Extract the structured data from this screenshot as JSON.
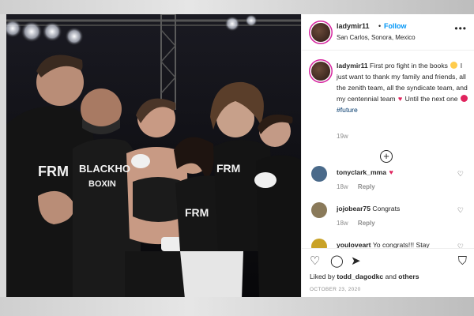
{
  "header": {
    "username": "ladymir11",
    "separator": "•",
    "follow_label": "Follow",
    "location": "San Carlos, Sonora, Mexico",
    "more_icon": "more-horizontal-icon"
  },
  "caption": {
    "username": "ladymir11",
    "text_part1": "First pro fight in the books",
    "text_part2": "I just want to thank my family and friends, all the zenith team, all the syndicate team, and my centennial team",
    "text_part3": "Until the next one",
    "hashtag": "#future",
    "time": "19w"
  },
  "comments": [
    {
      "username": "tonyclark_mma",
      "text": "",
      "time": "18w",
      "reply_label": "Reply",
      "avatar_color": "#4a6a8a"
    },
    {
      "username": "jojobear75",
      "text": "Congrats",
      "time": "18w",
      "reply_label": "Reply",
      "avatar_color": "#8a7a5a"
    },
    {
      "username": "youloveart",
      "text": "Yo congrats!!! Stay",
      "time": "",
      "reply_label": "",
      "avatar_color": "#c9a227"
    }
  ],
  "actions": {
    "like_icon": "heart-icon",
    "comment_icon": "comment-icon",
    "share_icon": "share-icon",
    "save_icon": "bookmark-icon",
    "liked_by_prefix": "Liked by",
    "liked_by_user": "todd_dagodkc",
    "liked_by_and": "and",
    "liked_by_others": "others",
    "date": "OCTOBER 23, 2020"
  },
  "photo": {
    "shirt_text_1": "FRM",
    "shirt_text_2": "BLACKHO",
    "shirt_text_3": "BOXIN",
    "shirt_text_4": "FRM",
    "shirt_text_5": "FRM"
  },
  "colors": {
    "follow": "#0095f6",
    "hashtag": "#00376b",
    "heart": "#e0245e",
    "avatar_ring": "#d6249f"
  }
}
